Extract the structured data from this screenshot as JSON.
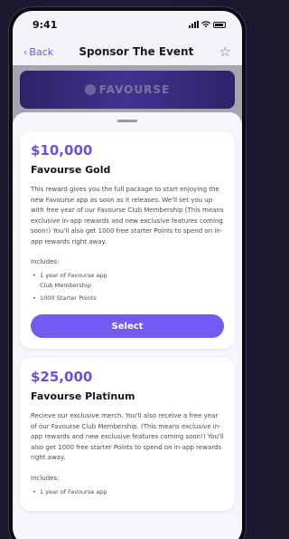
{
  "status": {
    "time": "9:41"
  },
  "nav": {
    "back_label": "Back",
    "title": "Sponsor The Event",
    "star_icon": "star-outline-icon"
  },
  "banner": {
    "brand": "FAVOURSE"
  },
  "theme": {
    "accent": "#7459f2",
    "price_color": "#6a4fe0"
  },
  "tiers": [
    {
      "price": "$10,000",
      "name": "Favourse Gold",
      "description": "This reward gives you the full package to start enjoying the new Favourse app as soon as it releases. We'll set you up with free year of our Favourse Club Membership (This means exclusive in-app rewards and new exclusive features coming soon!) You'll also get 1000 free starter Points to spend on in-app rewards right away.",
      "includes_label": "Includes:",
      "includes": [
        "1 year of Favourse app Club Membership",
        "1000 Starter Points"
      ],
      "button_label": "Select"
    },
    {
      "price": "$25,000",
      "name": "Favourse Platinum",
      "description": "Recieve our exclusive merch. You'll also receive a free year of our Favourse Club Membership. (This means exclusive in-app rewards and new exclusive features coming soon!) You'll also get 1000 free starter Points to spend on in-app rewards right away.",
      "includes_label": "Includes:",
      "includes": [
        "1 year of Favourse app"
      ]
    }
  ]
}
